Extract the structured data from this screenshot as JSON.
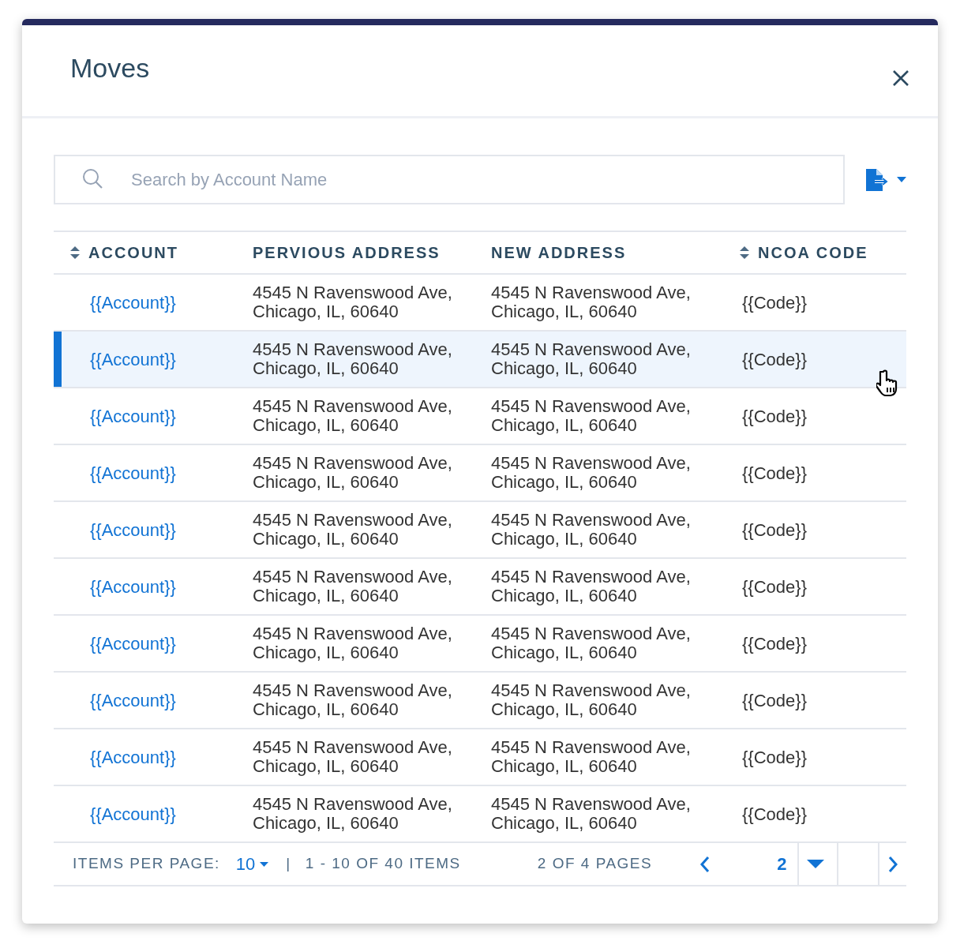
{
  "dialog": {
    "title": "Moves"
  },
  "search": {
    "placeholder": "Search by Account Name"
  },
  "table": {
    "columns": [
      {
        "label": "ACCOUNT",
        "sortable": true
      },
      {
        "label": "PERVIOUS ADDRESS",
        "sortable": false
      },
      {
        "label": "NEW ADDRESS",
        "sortable": false
      },
      {
        "label": "NCOA CODE",
        "sortable": true
      }
    ],
    "rows": [
      {
        "account": "{{Account}}",
        "previous_address": "4545 N Ravenswood Ave,\nChicago, IL, 60640",
        "new_address": "4545 N Ravenswood Ave,\nChicago, IL, 60640",
        "code": "{{Code}}",
        "selected": false
      },
      {
        "account": "{{Account}}",
        "previous_address": "4545 N Ravenswood Ave,\nChicago, IL, 60640",
        "new_address": "4545 N Ravenswood Ave,\nChicago, IL, 60640",
        "code": "{{Code}}",
        "selected": true
      },
      {
        "account": "{{Account}}",
        "previous_address": "4545 N Ravenswood Ave,\nChicago, IL, 60640",
        "new_address": "4545 N Ravenswood Ave,\nChicago, IL, 60640",
        "code": "{{Code}}",
        "selected": false
      },
      {
        "account": "{{Account}}",
        "previous_address": "4545 N Ravenswood Ave,\nChicago, IL, 60640",
        "new_address": "4545 N Ravenswood Ave,\nChicago, IL, 60640",
        "code": "{{Code}}",
        "selected": false
      },
      {
        "account": "{{Account}}",
        "previous_address": "4545 N Ravenswood Ave,\nChicago, IL, 60640",
        "new_address": "4545 N Ravenswood Ave,\nChicago, IL, 60640",
        "code": "{{Code}}",
        "selected": false
      },
      {
        "account": "{{Account}}",
        "previous_address": "4545 N Ravenswood Ave,\nChicago, IL, 60640",
        "new_address": "4545 N Ravenswood Ave,\nChicago, IL, 60640",
        "code": "{{Code}}",
        "selected": false
      },
      {
        "account": "{{Account}}",
        "previous_address": "4545 N Ravenswood Ave,\nChicago, IL, 60640",
        "new_address": "4545 N Ravenswood Ave,\nChicago, IL, 60640",
        "code": "{{Code}}",
        "selected": false
      },
      {
        "account": "{{Account}}",
        "previous_address": "4545 N Ravenswood Ave,\nChicago, IL, 60640",
        "new_address": "4545 N Ravenswood Ave,\nChicago, IL, 60640",
        "code": "{{Code}}",
        "selected": false
      },
      {
        "account": "{{Account}}",
        "previous_address": "4545 N Ravenswood Ave,\nChicago, IL, 60640",
        "new_address": "4545 N Ravenswood Ave,\nChicago, IL, 60640",
        "code": "{{Code}}",
        "selected": false
      },
      {
        "account": "{{Account}}",
        "previous_address": "4545 N Ravenswood Ave,\nChicago, IL, 60640",
        "new_address": "4545 N Ravenswood Ave,\nChicago, IL, 60640",
        "code": "{{Code}}",
        "selected": false
      }
    ]
  },
  "pagination": {
    "items_per_page_label": "ITEMS PER PAGE:",
    "items_per_page": "10",
    "separator": "|",
    "range": "1 - 10 OF 40 ITEMS",
    "pages": "2 OF 4 PAGES",
    "current_page": "2"
  }
}
